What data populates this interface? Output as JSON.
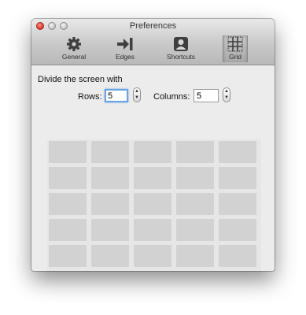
{
  "window": {
    "title": "Preferences"
  },
  "toolbar": {
    "items": [
      {
        "label": "General",
        "icon": "gear-icon"
      },
      {
        "label": "Edges",
        "icon": "arrow-to-edge-icon"
      },
      {
        "label": "Shortcuts",
        "icon": "person-icon"
      },
      {
        "label": "Grid",
        "icon": "grid-icon",
        "selected": true
      }
    ]
  },
  "grid_settings": {
    "heading": "Divide the screen with",
    "rows_label": "Rows:",
    "rows_value": "5",
    "columns_label": "Columns:",
    "columns_value": "5"
  },
  "grid_preview": {
    "rows": 5,
    "columns": 5
  },
  "colors": {
    "close": "#e0443a",
    "cell": "#d2d2d2",
    "focus": "#6aa1e3"
  }
}
